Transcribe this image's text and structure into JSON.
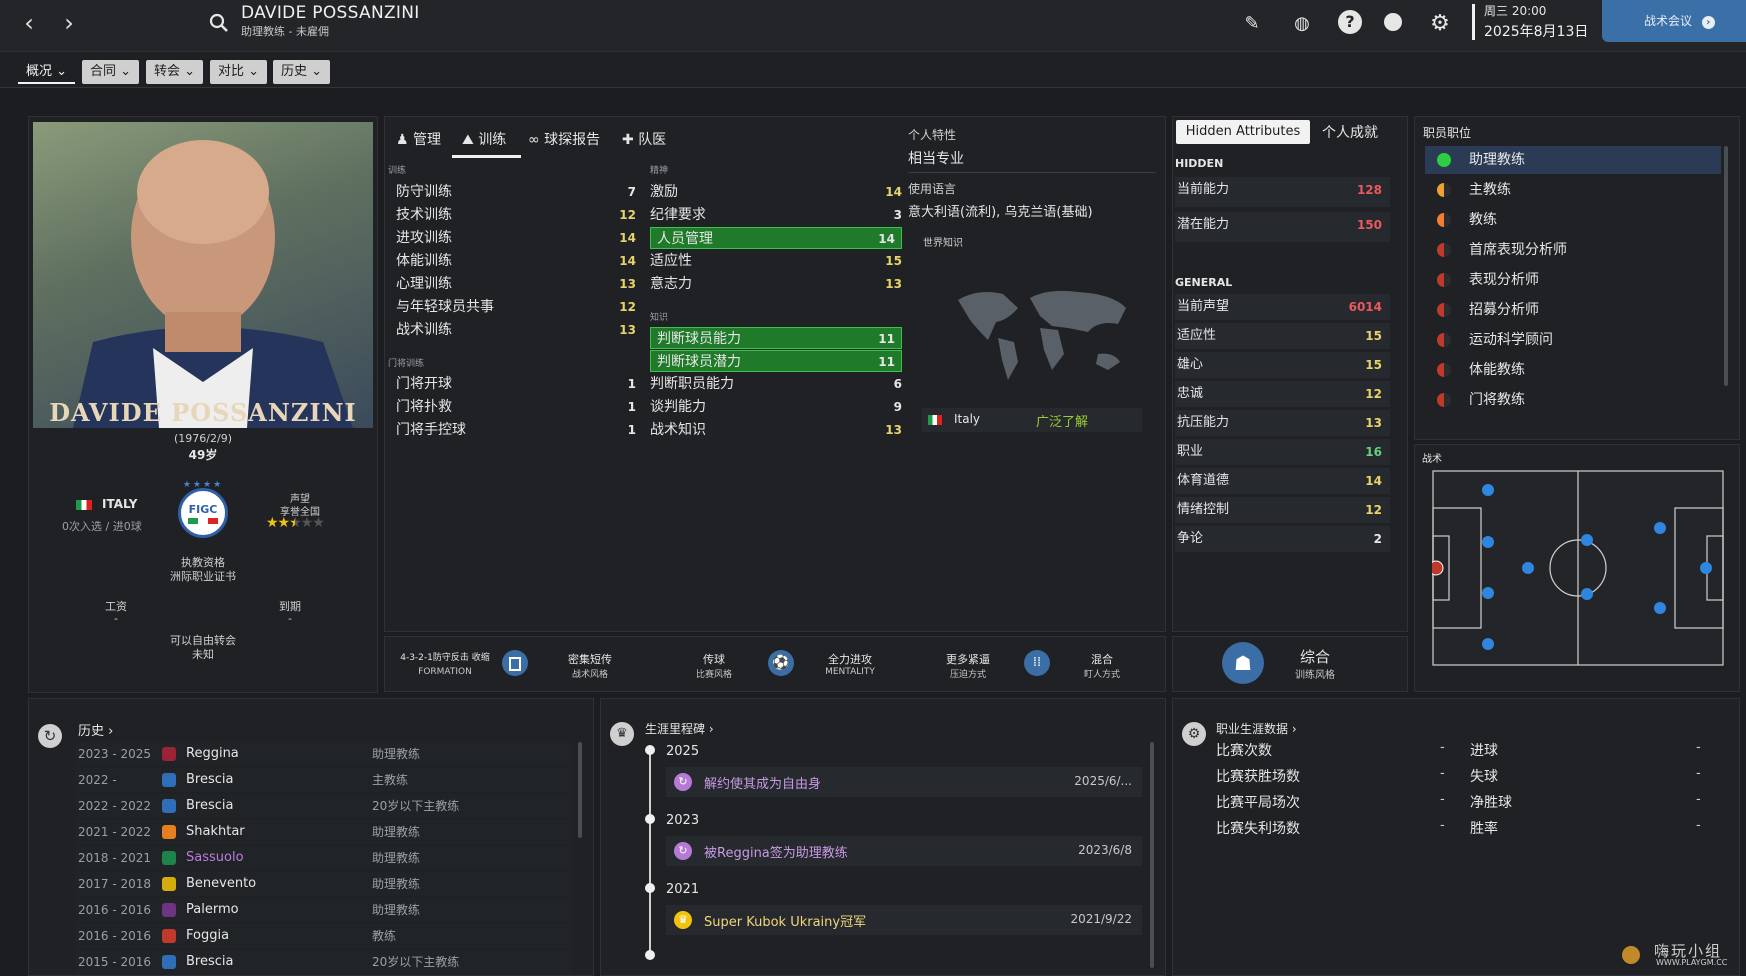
{
  "header": {
    "name": "DAVIDE POSSANZINI",
    "subtitle": "助理教练 - 未雇佣",
    "date_day": "周三 20:00",
    "date_full": "2025年8月13日",
    "meeting_btn": "战术会议"
  },
  "tabs": [
    {
      "label": "概况 ⌄"
    },
    {
      "label": "合同 ⌄"
    },
    {
      "label": "转会 ⌄"
    },
    {
      "label": "对比 ⌄"
    },
    {
      "label": "历史 ⌄"
    }
  ],
  "profile": {
    "photo_name": "DAVIDE POSSANZINI",
    "dob": "(1976/2/9)",
    "age": "49岁",
    "nation": "ITALY",
    "caps": "0次入选 / 进0球",
    "badge": "FIGC",
    "license_label": "执教资格",
    "license_value": "洲际职业证书",
    "rep_label": "声望",
    "rep_value": "享誉全国",
    "rep_stars": 2.5,
    "wage_label": "工资",
    "wage_value": "-",
    "expiry_label": "到期",
    "expiry_value": "-",
    "transfer_label": "可以自由转会",
    "transfer_value": "未知"
  },
  "attr_tabs": [
    {
      "label": "管理"
    },
    {
      "label": "训练"
    },
    {
      "label": "球探报告"
    },
    {
      "label": "队医"
    }
  ],
  "training": {
    "section": "训练",
    "items": [
      {
        "label": "防守训练",
        "value": "7"
      },
      {
        "label": "技术训练",
        "value": "12"
      },
      {
        "label": "进攻训练",
        "value": "14"
      },
      {
        "label": "体能训练",
        "value": "14"
      },
      {
        "label": "心理训练",
        "value": "13"
      },
      {
        "label": "与年轻球员共事",
        "value": "12"
      },
      {
        "label": "战术训练",
        "value": "13"
      }
    ],
    "gk_section": "门将训练",
    "gk_items": [
      {
        "label": "门将开球",
        "value": "1"
      },
      {
        "label": "门将扑救",
        "value": "1"
      },
      {
        "label": "门将手控球",
        "value": "1"
      }
    ]
  },
  "mental": {
    "section": "精神",
    "items": [
      {
        "label": "激励",
        "value": "14"
      },
      {
        "label": "纪律要求",
        "value": "3"
      },
      {
        "label": "人员管理",
        "value": "14"
      },
      {
        "label": "适应性",
        "value": "15"
      },
      {
        "label": "意志力",
        "value": "13"
      }
    ],
    "knowledge_section": "知识",
    "knowledge_items": [
      {
        "label": "判断球员能力",
        "value": "11"
      },
      {
        "label": "判断球员潜力",
        "value": "11"
      },
      {
        "label": "判断职员能力",
        "value": "6"
      },
      {
        "label": "谈判能力",
        "value": "9"
      },
      {
        "label": "战术知识",
        "value": "13"
      }
    ]
  },
  "traits": {
    "label": "个人特性",
    "value": "相当专业",
    "lang_label": "使用语言",
    "lang_value": "意大利语(流利), 乌克兰语(基础)",
    "world_label": "世界知识",
    "country": "Italy",
    "knowledge": "广泛了解"
  },
  "style_bar": {
    "formation": "4-3-2-1防守反击 收缩",
    "formation_lbl": "FORMATION",
    "pass": "密集短传",
    "pass_lbl": "战术风格",
    "pass2": "传球",
    "pass2_lbl": "比赛风格",
    "attack": "全力进攻",
    "attack_lbl": "MENTALITY",
    "press": "更多紧逼",
    "press_lbl": "压迫方式",
    "mark": "混合",
    "mark_lbl": "盯人方式",
    "train": "综合",
    "train_lbl": "训练风格"
  },
  "hidden": {
    "tab1": "Hidden Attributes",
    "tab2": "个人成就",
    "hidden_lbl": "HIDDEN",
    "ca_label": "当前能力",
    "ca": "128",
    "pa_label": "潜在能力",
    "pa": "150",
    "general_lbl": "GENERAL",
    "items": [
      {
        "label": "当前声望",
        "value": "6014"
      },
      {
        "label": "适应性",
        "value": "15"
      },
      {
        "label": "雄心",
        "value": "15"
      },
      {
        "label": "忠诚",
        "value": "12"
      },
      {
        "label": "抗压能力",
        "value": "13"
      },
      {
        "label": "职业",
        "value": "16"
      },
      {
        "label": "体育道德",
        "value": "14"
      },
      {
        "label": "情绪控制",
        "value": "12"
      },
      {
        "label": "争论",
        "value": "2"
      }
    ]
  },
  "positions": {
    "title": "职员职位",
    "items": [
      {
        "label": "助理教练",
        "color": "#2ecc40"
      },
      {
        "label": "主教练",
        "color": "#f0a030"
      },
      {
        "label": "教练",
        "color": "#f08030"
      },
      {
        "label": "首席表现分析师",
        "color": "#c0392b"
      },
      {
        "label": "表现分析师",
        "color": "#c0392b"
      },
      {
        "label": "招募分析师",
        "color": "#c0392b"
      },
      {
        "label": "运动科学顾问",
        "color": "#c0392b"
      },
      {
        "label": "体能教练",
        "color": "#c0392b"
      },
      {
        "label": "门将教练",
        "color": "#c0392b"
      }
    ]
  },
  "tactics_title": "战术",
  "history": {
    "title": "历史",
    "rows": [
      {
        "years": "2023 - 2025",
        "club": "Reggina",
        "role": "助理教练",
        "crest": "#9b2335"
      },
      {
        "years": "2022 -",
        "club": "Brescia",
        "role": "主教练",
        "crest": "#2e6fb7"
      },
      {
        "years": "2022 - 2022",
        "club": "Brescia",
        "role": "20岁以下主教练",
        "crest": "#2e6fb7"
      },
      {
        "years": "2021 - 2022",
        "club": "Shakhtar",
        "role": "助理教练",
        "crest": "#e67e22"
      },
      {
        "years": "2018 - 2021",
        "club": "Sassuolo",
        "role": "助理教练",
        "crest": "#1e8449"
      },
      {
        "years": "2017 - 2018",
        "club": "Benevento",
        "role": "助理教练",
        "crest": "#d4ac0d"
      },
      {
        "years": "2016 - 2016",
        "club": "Palermo",
        "role": "助理教练",
        "crest": "#6c3483"
      },
      {
        "years": "2016 - 2016",
        "club": "Foggia",
        "role": "教练",
        "crest": "#c0392b"
      },
      {
        "years": "2015 - 2016",
        "club": "Brescia",
        "role": "20岁以下主教练",
        "crest": "#2e6fb7"
      }
    ]
  },
  "milestones": {
    "title": "生涯里程碑",
    "items": [
      {
        "year": "2025",
        "text": "解约使其成为自由身",
        "date": "2025/6/..."
      },
      {
        "year": "2023",
        "text": "被Reggina签为助理教练",
        "date": "2023/6/8"
      },
      {
        "year": "2021",
        "text": "Super Kubok Ukrainy冠军",
        "date": "2021/9/22"
      }
    ]
  },
  "career": {
    "title": "职业生涯数据",
    "left": [
      {
        "label": "比赛次数",
        "value": "-"
      },
      {
        "label": "比赛获胜场数",
        "value": "-"
      },
      {
        "label": "比赛平局场次",
        "value": "-"
      },
      {
        "label": "比赛失利场数",
        "value": "-"
      }
    ],
    "right": [
      {
        "label": "进球",
        "value": "-"
      },
      {
        "label": "失球",
        "value": "-"
      },
      {
        "label": "净胜球",
        "value": "-"
      },
      {
        "label": "胜率",
        "value": "-"
      }
    ]
  },
  "watermark": {
    "line1": "嗨玩小组",
    "line2": "WWW.PLAYGM.CC"
  }
}
